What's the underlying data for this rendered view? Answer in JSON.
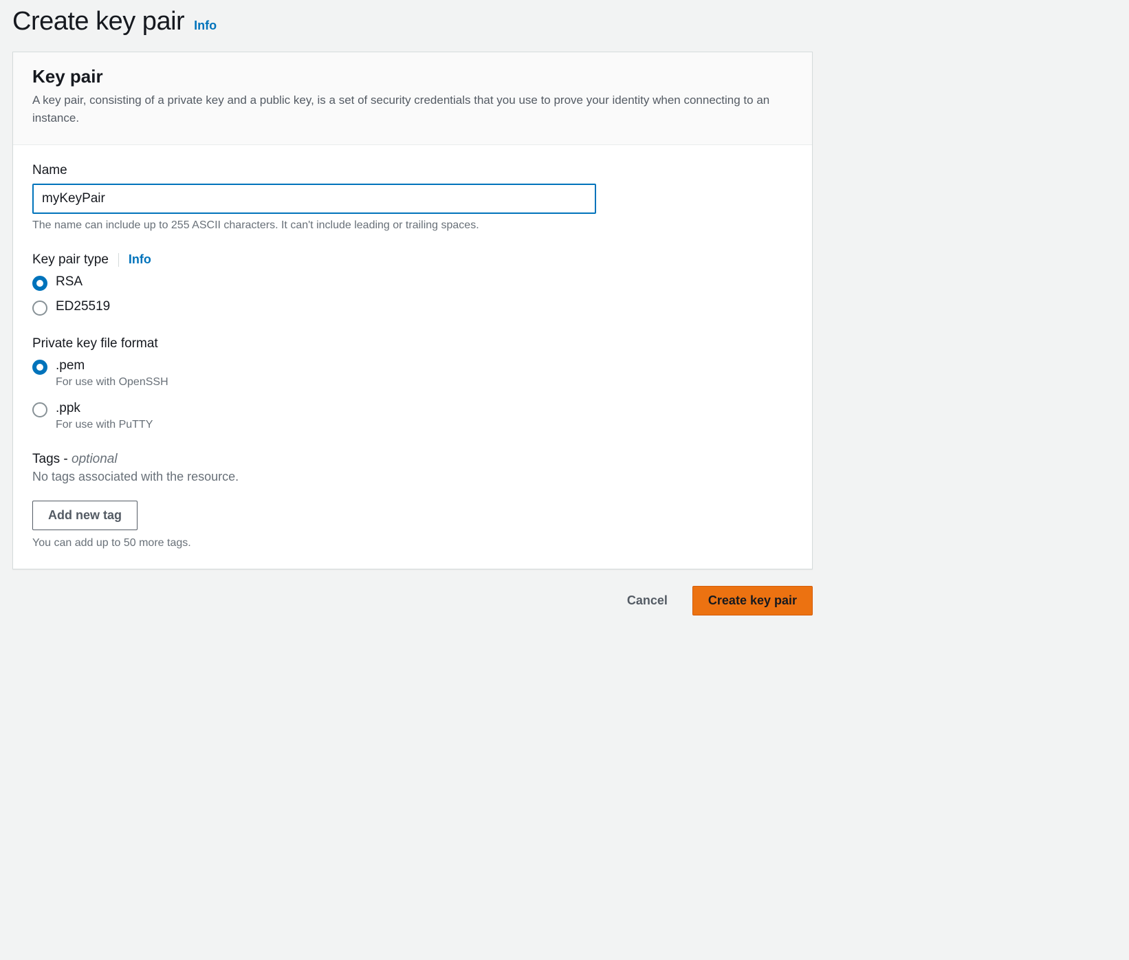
{
  "header": {
    "title": "Create key pair",
    "info_label": "Info"
  },
  "panel": {
    "title": "Key pair",
    "description": "A key pair, consisting of a private key and a public key, is a set of security credentials that you use to prove your identity when connecting to an instance."
  },
  "name_field": {
    "label": "Name",
    "value": "myKeyPair",
    "hint": "The name can include up to 255 ASCII characters. It can't include leading or trailing spaces."
  },
  "type_field": {
    "label": "Key pair type",
    "info_label": "Info",
    "options": [
      {
        "label": "RSA",
        "selected": true
      },
      {
        "label": "ED25519",
        "selected": false
      }
    ]
  },
  "format_field": {
    "label": "Private key file format",
    "options": [
      {
        "label": ".pem",
        "desc": "For use with OpenSSH",
        "selected": true
      },
      {
        "label": ".ppk",
        "desc": "For use with PuTTY",
        "selected": false
      }
    ]
  },
  "tags_field": {
    "label": "Tags - ",
    "optional_label": "optional",
    "empty_text": "No tags associated with the resource.",
    "add_button": "Add new tag",
    "limit_text": "You can add up to 50 more tags."
  },
  "footer": {
    "cancel": "Cancel",
    "submit": "Create key pair"
  }
}
